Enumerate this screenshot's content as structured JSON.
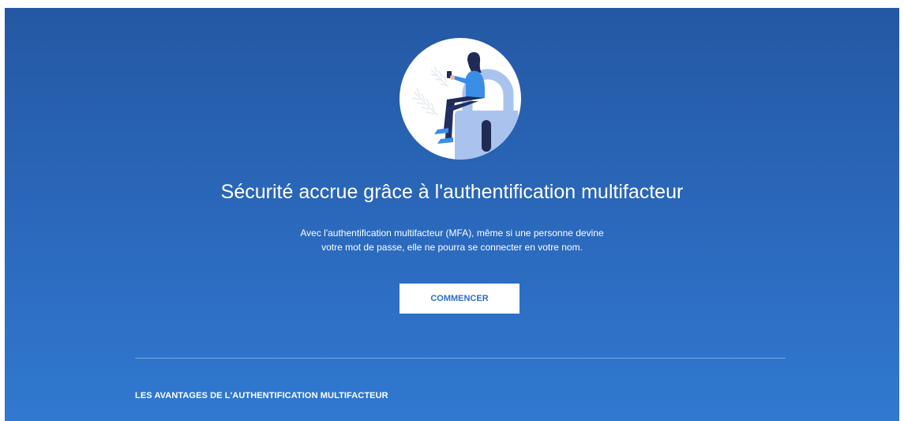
{
  "hero": {
    "illustration_icon": "person-on-padlock-illustration",
    "title": "Sécurité accrue grâce à l'authentification multifacteur",
    "description_lines": [
      "Avec l'authentification multifacteur (MFA), même si une personne devine",
      "votre mot de passe, elle ne pourra se connecter en votre nom."
    ],
    "cta_label": "COMMENCER"
  },
  "benefits": {
    "heading": "LES AVANTAGES DE L'AUTHENTIFICATION MULTIFACTEUR"
  },
  "colors": {
    "background_top": "#2458a4",
    "background_bottom": "#3079d1",
    "button_text": "#2d6ec8",
    "text": "#ffffff"
  }
}
